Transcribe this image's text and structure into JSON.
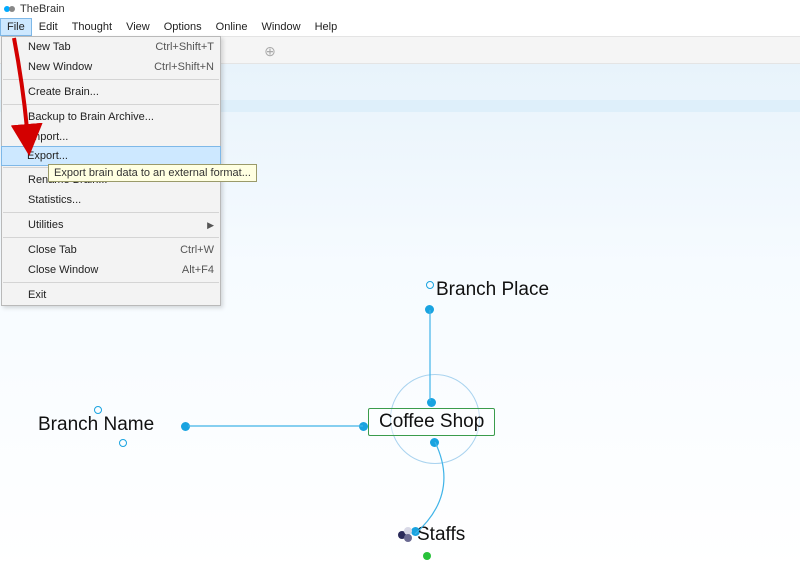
{
  "app": {
    "title": "TheBrain"
  },
  "menus": [
    "File",
    "Edit",
    "Thought",
    "View",
    "Options",
    "Online",
    "Window",
    "Help"
  ],
  "fileMenu": {
    "newTab": "New Tab",
    "newTabKb": "Ctrl+Shift+T",
    "newWindow": "New Window",
    "newWindowKb": "Ctrl+Shift+N",
    "createBrain": "Create Brain...",
    "backup": "Backup to Brain Archive...",
    "import": "Import...",
    "export": "Export...",
    "rename": "Rename Brain...",
    "statistics": "Statistics...",
    "utilities": "Utilities",
    "closeTab": "Close Tab",
    "closeTabKb": "Ctrl+W",
    "closeWindow": "Close Window",
    "closeWindowKb": "Alt+F4",
    "exit": "Exit"
  },
  "tooltip": "Export brain data to an external format...",
  "graph": {
    "central": "Coffee Shop",
    "parent": "Branch Place",
    "jump": "Branch Name",
    "child": "Staffs"
  }
}
